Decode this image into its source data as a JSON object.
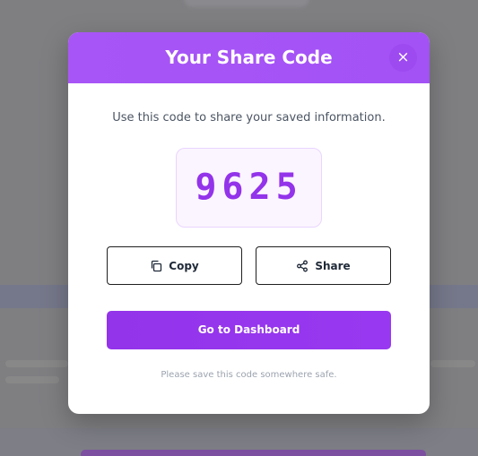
{
  "modal": {
    "title": "Your Share Code",
    "close_icon": "×",
    "subtitle": "Use this code to share your saved information.",
    "code": "9625",
    "copy_label": "Copy",
    "share_label": "Share",
    "dashboard_label": "Go to Dashboard",
    "footnote": "Please save this code somewhere safe."
  },
  "icons": {
    "close": "close-icon",
    "copy": "copy-icon",
    "share": "share-icon"
  },
  "colors": {
    "header": "#a855f7",
    "accent": "#9333ea",
    "code_bg": "#fbf5ff"
  }
}
